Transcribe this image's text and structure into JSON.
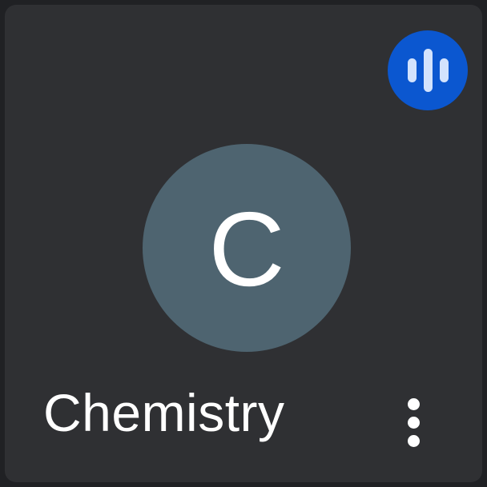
{
  "participant": {
    "avatar_initial": "C",
    "name": "Chemistry",
    "avatar_color": "#4e6470"
  },
  "indicators": {
    "audio_icon": "audio-level-icon",
    "audio_color": "#0b57d0",
    "more_icon": "more-vertical-icon"
  }
}
